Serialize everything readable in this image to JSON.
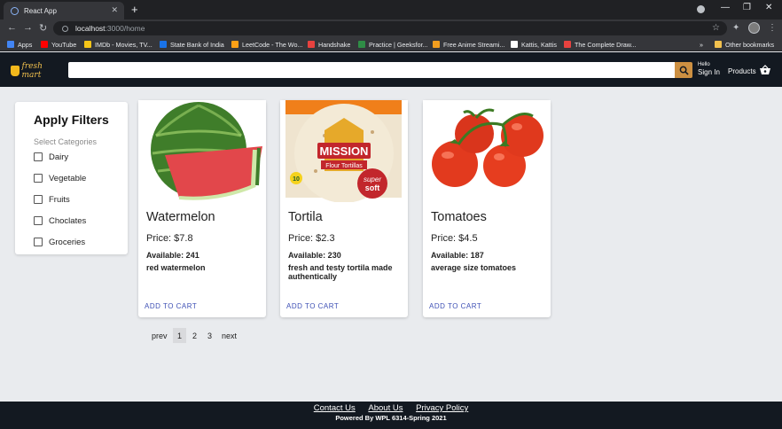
{
  "browser": {
    "tab_title": "React App",
    "url_host": "localhost",
    "url_path": ":3000/home",
    "bookmarks": [
      "Apps",
      "YouTube",
      "IMDb - Movies, TV...",
      "State Bank of India",
      "LeetCode - The Wo...",
      "Handshake",
      "Practice | Geeksfor...",
      "Free Anime Streami...",
      "Kattis, Kattis",
      "The Complete Draw...",
      "Other bookmarks"
    ],
    "bookmark_colors": [
      "#4285f4",
      "#ff0000",
      "#f5c518",
      "#1a73e8",
      "#ffa116",
      "#e8423f",
      "#2f8d46",
      "#f29e1f",
      "#ffffff",
      "#e8423f",
      "#f2c14e"
    ]
  },
  "header": {
    "logo_text": "fresh mart",
    "search_placeholder": "",
    "hello": "Hello",
    "signin": "Sign In",
    "products": "Products"
  },
  "filters": {
    "title": "Apply Filters",
    "subtitle": "Select Categories",
    "categories": [
      "Dairy",
      "Vegetable",
      "Fruits",
      "Choclates",
      "Groceries"
    ]
  },
  "products": [
    {
      "name": "Watermelon",
      "price": "Price: $7.8",
      "available": "Available: 241",
      "description": "red watermelon",
      "action": "ADD TO CART"
    },
    {
      "name": "Tortila",
      "price": "Price: $2.3",
      "available": "Available: 230",
      "description": "fresh and testy tortila made authentically",
      "action": "ADD TO CART"
    },
    {
      "name": "Tomatoes",
      "price": "Price: $4.5",
      "available": "Available: 187",
      "description": "average size tomatoes",
      "action": "ADD TO CART"
    }
  ],
  "tortilla_pack": {
    "brand": "MISSION",
    "line1": "Flour Tortillas",
    "badge1": "super",
    "badge2": "soft",
    "count": "10"
  },
  "pagination": {
    "prev": "prev",
    "pages": [
      "1",
      "2",
      "3"
    ],
    "active": "1",
    "next": "next"
  },
  "footer": {
    "links": [
      "Contact Us",
      "About Us",
      "Privacy Policy"
    ],
    "powered": "Powered By WPL 6314-Spring 2021"
  }
}
